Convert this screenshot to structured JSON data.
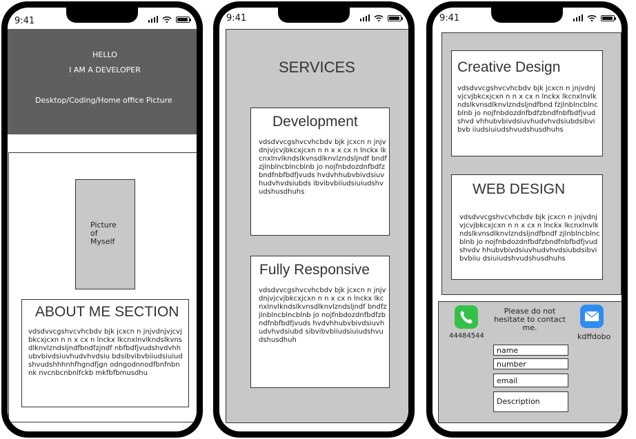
{
  "status_bar": {
    "time": "9:41"
  },
  "phone1": {
    "hero": {
      "line1": "HELLO",
      "line2": "I AM A DEVELOPER",
      "line3": "Desktop/Coding/Home office Picture"
    },
    "picture_placeholder": "Picture of Myself",
    "about": {
      "title": "ABOUT ME SECTION",
      "body": "vdsdvvcgshvcvhcbdv bjk jcxcn n jnjvdnjvjcvjbkcxjcxn n n x cx n lnckx lkcnxlnvlkndslkvnsdlknvlzndsljndfbndfzjndf nbfbdfjvudshvdvhhubvbivdsiuvhudvhvdsiu bdsibvibvbiiudsiuiudshvudshhhnhfhgndfjgn odngodnnodfbnfnbnnk nvcnbcnbnlfckb mkfbfbmusdhu"
    },
    "colors": {
      "hero_bg": "#5f5f5f",
      "placeholder_bg": "#c8c8c8"
    }
  },
  "phone2": {
    "title": "SERVICES",
    "cards": [
      {
        "title": "Development",
        "body": "vdsdvvcgshvcvhcbdv bjk jcxcn n jnjvdnjvjcvjbkcxjcxn n n x x  cx n lnckx lkcnxlnvlkndslkvnsdlknvlzndsljndf bndfzjlnblncblncblnb jo nojfnbdozdnfbdfzbndfnbfbdfjvuds hvdvhhubvbivdsiuvhudvhvdsiubds ibvibvbiiudsiuiudshvudshusdhuhs"
      },
      {
        "title": "Fully Responsive",
        "body": "vdsdvvcgshvcvhcbdv bjk jcxcn n jnjvdnjvjcvjbkcxjcxn n n x cx n lnckx lkcnxlnvlkndslkvnsdlknvlzndsljndf bndfzjlnblncblncblnb jo nojfnbdozdnfbdfzbndfnbfbdfjvuds hvdvhhubvbivdsiuvhudvhvdsiubd sibvibvbiiudsiuiudshvudshusdhuh"
      }
    ]
  },
  "phone3": {
    "cards": [
      {
        "title": "Creative Design",
        "body": "vdsdvvcgshvcvhcbdv bjk jcxcn n jnjvdnjvjcvjbkcxjcxn n n x cx n lnckx lkcnxlnvlkndslkvnsdlknvlzndsljndfbnd fzjlnblncblncblnb jo nojfnbdozdnfbdfzbndfnbfbdfjvudshvd vhhubvbivdsiuvhudvhvdsiubdsibvibvb iiudsiuiudshvudshusdhuhs"
      },
      {
        "title": "WEB DESIGN",
        "body": "vdsdvvcgshvcvhcbdv bjk jcxcn n jnjvdnjvjcvjbkcxjcxn n n x cx n lnckx lkcnxlnvlkndslkvnsdlknvlzndsljndfbndf zjlnblncblncblnb jo nojfnbdozdnfbdfzbndfnbfbdfjvudshvdv hhubvbivdsiuvhudvhvdsiubdsibvibvbiiu dsiuiudshvudshusdhuhs"
      }
    ],
    "contact": {
      "message": "Please do not hesitate to contact me.",
      "phone_number": "44484544",
      "mail_label": "kdffdobo",
      "fields": {
        "name": "name",
        "number": "number",
        "email": "email",
        "description": "Description"
      },
      "icons": {
        "phone": "phone-app-icon",
        "mail": "mail-app-icon"
      },
      "colors": {
        "phone_icon": "#35c04a",
        "mail_icon": "#2f8cf0"
      }
    }
  }
}
